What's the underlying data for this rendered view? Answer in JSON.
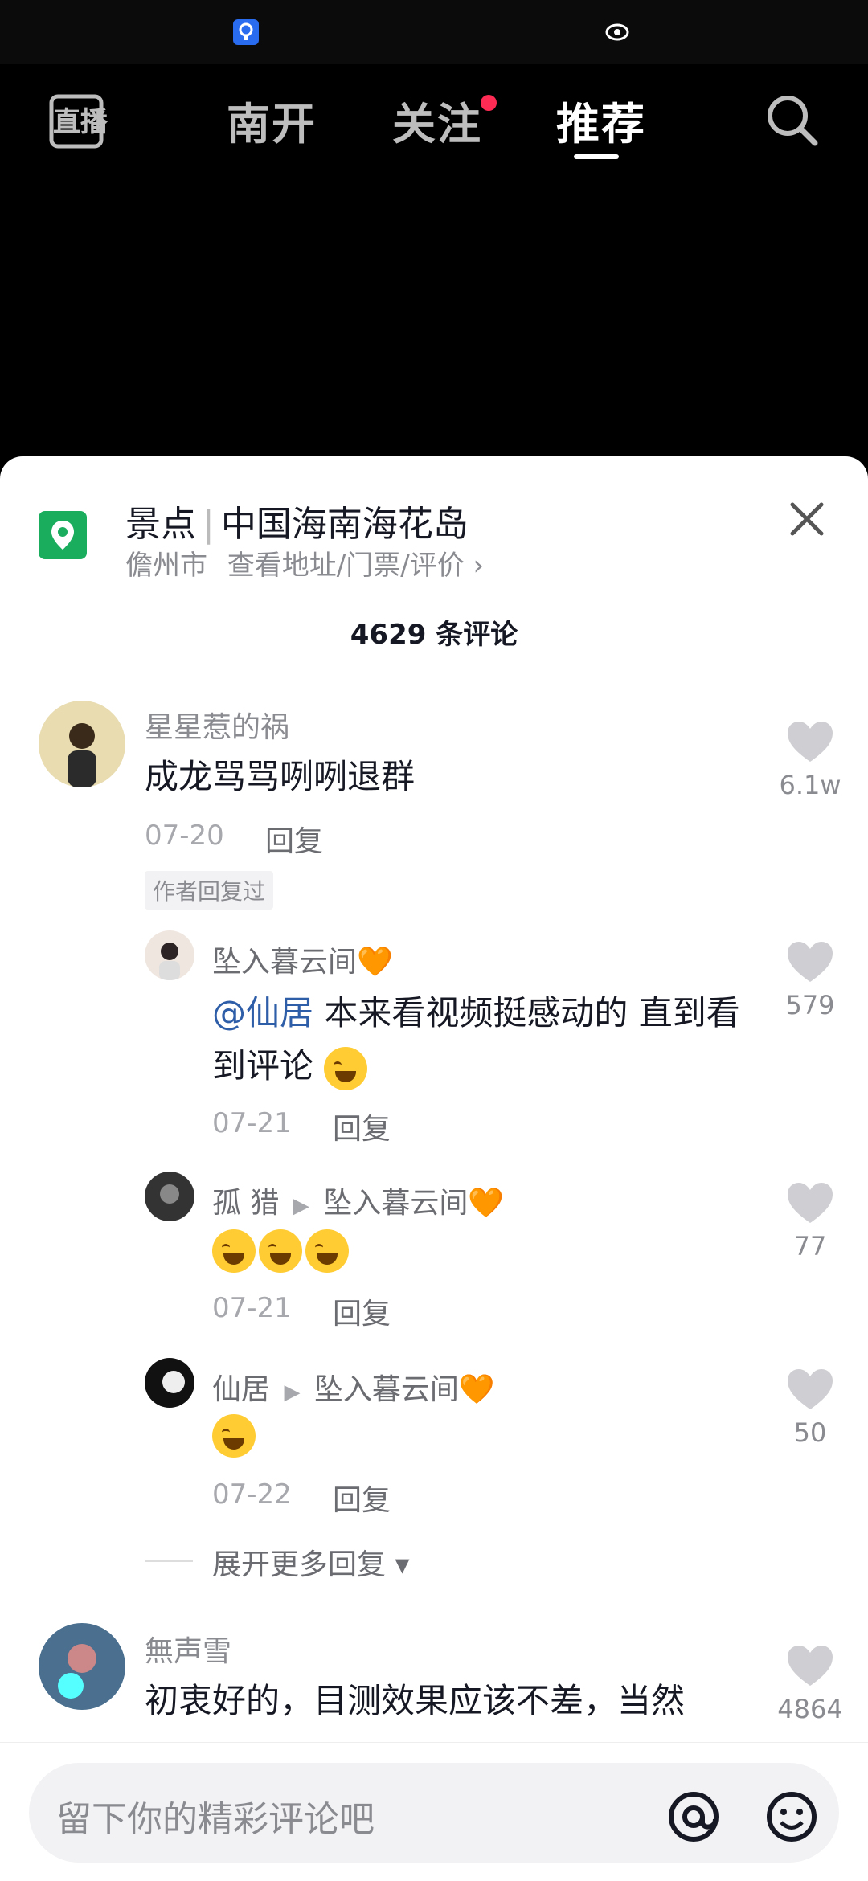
{
  "nav": {
    "live": "直播",
    "tab1": "南开",
    "tab2": "关注",
    "tab3": "推荐"
  },
  "location": {
    "category": "景点",
    "title": "中国海南海花岛",
    "city": "儋州市",
    "link": "查看地址/门票/评价 ›"
  },
  "comments_count": "4629 条评论",
  "comments": [
    {
      "user": "星星惹的祸",
      "text": "成龙骂骂咧咧退群",
      "date": "07-20",
      "reply": "回复",
      "badge": "作者回复过",
      "likes": "6.1w"
    },
    {
      "user": "坠入暮云间🧡",
      "at": "@仙居",
      "text": " 本来看视频挺感动的 直到看到评论",
      "date": "07-21",
      "reply": "回复",
      "likes": "579"
    },
    {
      "user": "孤  猎",
      "to": "坠入暮云间🧡",
      "date": "07-21",
      "reply": "回复",
      "likes": "77"
    },
    {
      "user": "仙居",
      "to": "坠入暮云间🧡",
      "date": "07-22",
      "reply": "回复",
      "likes": "50"
    },
    {
      "user": "無声雪",
      "text": "初衷好的，目测效果应该不差，当然",
      "likes": "4864"
    }
  ],
  "expand_more": "展开更多回复 ▾",
  "input_placeholder": "留下你的精彩评论吧",
  "colors": {
    "accent": "#fe2c55",
    "location_green": "#1aad5e"
  }
}
